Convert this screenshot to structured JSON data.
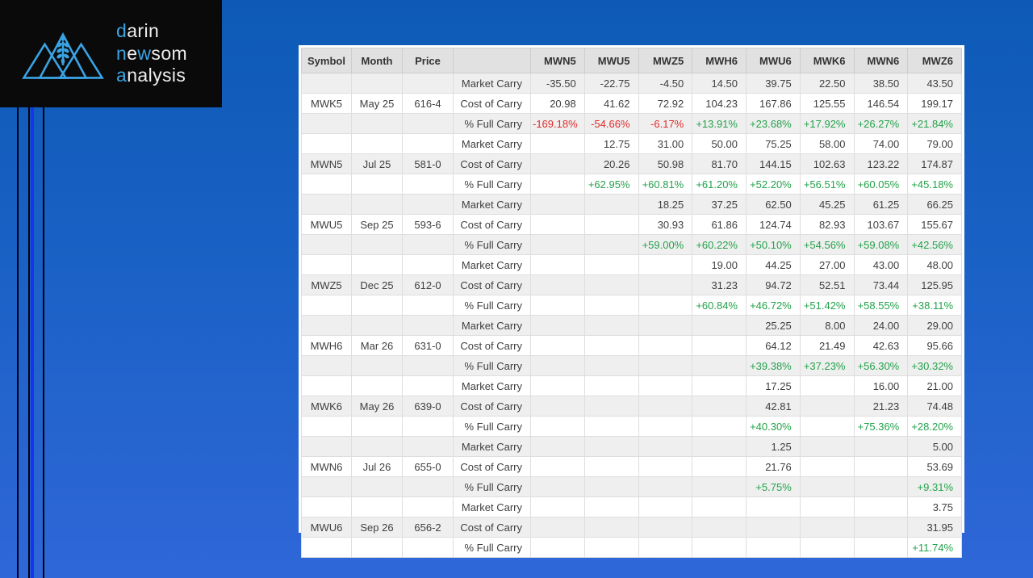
{
  "logo": {
    "line1_a": "d",
    "line1_b": "arin",
    "line2_a": "n",
    "line2_b": "e",
    "line2_c": "w",
    "line2_d": "som",
    "line3_a": "a",
    "line3_b": "nalysis",
    "icon": "mountains-wheat-icon",
    "accent_color": "#3aa3e3",
    "background_color": "#0a0a0a"
  },
  "colors": {
    "positive": "#24a24b",
    "negative": "#e12b2b",
    "desktop_top": "#0d5ab6",
    "desktop_bottom": "#2f67d8",
    "stripe_gray": "#efefef",
    "decor_blue_line": "#1535ec"
  },
  "table": {
    "fixed_headers": [
      "Symbol",
      "Month",
      "Price",
      ""
    ],
    "contract_headers": [
      "MWN5",
      "MWU5",
      "MWZ5",
      "MWH6",
      "MWU6",
      "MWK6",
      "MWN6",
      "MWZ6"
    ],
    "row_labels": {
      "market": "Market Carry",
      "cost": "Cost of Carry",
      "full": "% Full Carry"
    },
    "groups": [
      {
        "symbol": "MWK5",
        "month": "May 25",
        "price": "616-4",
        "market": [
          "-35.50",
          "-22.75",
          "-4.50",
          "14.50",
          "39.75",
          "22.50",
          "38.50",
          "43.50"
        ],
        "cost": [
          "20.98",
          "41.62",
          "72.92",
          "104.23",
          "167.86",
          "125.55",
          "146.54",
          "199.17"
        ],
        "full": [
          "-169.18%",
          "-54.66%",
          "-6.17%",
          "+13.91%",
          "+23.68%",
          "+17.92%",
          "+26.27%",
          "+21.84%"
        ]
      },
      {
        "symbol": "MWN5",
        "month": "Jul 25",
        "price": "581-0",
        "market": [
          "",
          "12.75",
          "31.00",
          "50.00",
          "75.25",
          "58.00",
          "74.00",
          "79.00"
        ],
        "cost": [
          "",
          "20.26",
          "50.98",
          "81.70",
          "144.15",
          "102.63",
          "123.22",
          "174.87"
        ],
        "full": [
          "",
          "+62.95%",
          "+60.81%",
          "+61.20%",
          "+52.20%",
          "+56.51%",
          "+60.05%",
          "+45.18%"
        ]
      },
      {
        "symbol": "MWU5",
        "month": "Sep 25",
        "price": "593-6",
        "market": [
          "",
          "",
          "18.25",
          "37.25",
          "62.50",
          "45.25",
          "61.25",
          "66.25"
        ],
        "cost": [
          "",
          "",
          "30.93",
          "61.86",
          "124.74",
          "82.93",
          "103.67",
          "155.67"
        ],
        "full": [
          "",
          "",
          "+59.00%",
          "+60.22%",
          "+50.10%",
          "+54.56%",
          "+59.08%",
          "+42.56%"
        ]
      },
      {
        "symbol": "MWZ5",
        "month": "Dec 25",
        "price": "612-0",
        "market": [
          "",
          "",
          "",
          "19.00",
          "44.25",
          "27.00",
          "43.00",
          "48.00"
        ],
        "cost": [
          "",
          "",
          "",
          "31.23",
          "94.72",
          "52.51",
          "73.44",
          "125.95"
        ],
        "full": [
          "",
          "",
          "",
          "+60.84%",
          "+46.72%",
          "+51.42%",
          "+58.55%",
          "+38.11%"
        ]
      },
      {
        "symbol": "MWH6",
        "month": "Mar 26",
        "price": "631-0",
        "market": [
          "",
          "",
          "",
          "",
          "25.25",
          "8.00",
          "24.00",
          "29.00"
        ],
        "cost": [
          "",
          "",
          "",
          "",
          "64.12",
          "21.49",
          "42.63",
          "95.66"
        ],
        "full": [
          "",
          "",
          "",
          "",
          "+39.38%",
          "+37.23%",
          "+56.30%",
          "+30.32%"
        ]
      },
      {
        "symbol": "MWK6",
        "month": "May 26",
        "price": "639-0",
        "market": [
          "",
          "",
          "",
          "",
          "17.25",
          "",
          "16.00",
          "21.00"
        ],
        "cost": [
          "",
          "",
          "",
          "",
          "42.81",
          "",
          "21.23",
          "74.48"
        ],
        "full": [
          "",
          "",
          "",
          "",
          "+40.30%",
          "",
          "+75.36%",
          "+28.20%"
        ]
      },
      {
        "symbol": "MWN6",
        "month": "Jul 26",
        "price": "655-0",
        "market": [
          "",
          "",
          "",
          "",
          "1.25",
          "",
          "",
          "5.00"
        ],
        "cost": [
          "",
          "",
          "",
          "",
          "21.76",
          "",
          "",
          "53.69"
        ],
        "full": [
          "",
          "",
          "",
          "",
          "+5.75%",
          "",
          "",
          "+9.31%"
        ]
      },
      {
        "symbol": "MWU6",
        "month": "Sep 26",
        "price": "656-2",
        "market": [
          "",
          "",
          "",
          "",
          "",
          "",
          "",
          "3.75"
        ],
        "cost": [
          "",
          "",
          "",
          "",
          "",
          "",
          "",
          "31.95"
        ],
        "full": [
          "",
          "",
          "",
          "",
          "",
          "",
          "",
          "+11.74%"
        ]
      }
    ]
  }
}
